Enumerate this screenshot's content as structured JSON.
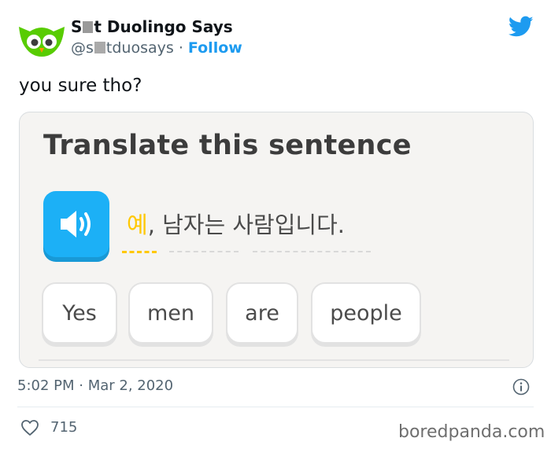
{
  "author": {
    "name_pre": "S",
    "name_post": "t Duolingo Says",
    "handle_pre": "@s",
    "handle_post": "tduosays",
    "separator": "·",
    "follow_label": "Follow"
  },
  "tweet": {
    "text": "you sure tho?",
    "timestamp": "5:02 PM · Mar 2, 2020",
    "likes": "715"
  },
  "card": {
    "title": "Translate this sentence",
    "sentence_highlight": "예",
    "sentence_rest": ", 남자는 사람입니다.",
    "word_bank": [
      "Yes",
      "men",
      "are",
      "people"
    ]
  },
  "watermark": "boredpanda.com",
  "colors": {
    "twitter_blue": "#1d9bf0",
    "duolingo_blue": "#1cb0f6",
    "duolingo_green": "#58cc02",
    "highlight_yellow": "#ffc800"
  },
  "icons": [
    "owl-avatar-icon",
    "twitter-bird-icon",
    "speaker-icon",
    "info-icon",
    "heart-icon"
  ]
}
